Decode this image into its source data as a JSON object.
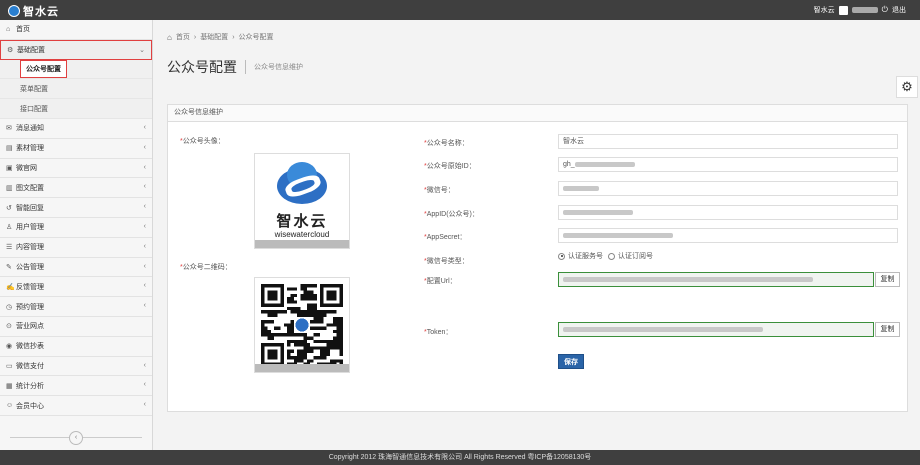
{
  "topbar": {
    "brand": "智水云",
    "user": "智水云",
    "logout": "退出"
  },
  "sidebar": {
    "items": [
      {
        "icon": "home-icon",
        "glyph": "⌂",
        "label": "首页"
      },
      {
        "icon": "gear-icon",
        "glyph": "⚙",
        "label": "基础配置",
        "expanded": true,
        "children": [
          {
            "label": "公众号配置",
            "current": true
          },
          {
            "label": "菜单配置"
          },
          {
            "label": "接口配置"
          }
        ]
      },
      {
        "icon": "message-icon",
        "glyph": "✉",
        "label": "消息通知"
      },
      {
        "icon": "material-icon",
        "glyph": "▤",
        "label": "素材管理"
      },
      {
        "icon": "site-icon",
        "glyph": "▣",
        "label": "微官网"
      },
      {
        "icon": "image-text-icon",
        "glyph": "▥",
        "label": "图文配置"
      },
      {
        "icon": "auto-reply-icon",
        "glyph": "↺",
        "label": "智能回复"
      },
      {
        "icon": "user-icon",
        "glyph": "♙",
        "label": "用户管理"
      },
      {
        "icon": "content-icon",
        "glyph": "☰",
        "label": "内容管理"
      },
      {
        "icon": "notice-icon",
        "glyph": "✎",
        "label": "公告管理"
      },
      {
        "icon": "feedback-icon",
        "glyph": "✍",
        "label": "反馈管理"
      },
      {
        "icon": "booking-icon",
        "glyph": "◷",
        "label": "预约管理"
      },
      {
        "icon": "location-icon",
        "glyph": "⊙",
        "label": "营业网点"
      },
      {
        "icon": "meter-icon",
        "glyph": "◉",
        "label": "微信抄表"
      },
      {
        "icon": "payment-icon",
        "glyph": "▭",
        "label": "微信支付"
      },
      {
        "icon": "stats-icon",
        "glyph": "▦",
        "label": "统计分析"
      },
      {
        "icon": "member-icon",
        "glyph": "☺",
        "label": "会员中心"
      }
    ]
  },
  "breadcrumb": [
    "首页",
    "基础配置",
    "公众号配置"
  ],
  "page": {
    "title": "公众号配置",
    "subtitle": "公众号信息维护"
  },
  "panel": {
    "title": "公众号信息维护",
    "avatar_label": "公众号头像：",
    "qr_label": "公众号二维码：",
    "logo_cn": "智水云",
    "logo_en": "wisewatercloud",
    "fields": {
      "name": {
        "label": "公众号名称：",
        "value": "智水云"
      },
      "original_id": {
        "label": "公众号原始ID：",
        "value": "gh_"
      },
      "wechat_id": {
        "label": "微信号：",
        "value": ""
      },
      "appid": {
        "label": "AppID(公众号)：",
        "value": ""
      },
      "appsecret": {
        "label": "AppSecret：",
        "value": ""
      },
      "type": {
        "label": "微信号类型：",
        "options": [
          "认证服务号",
          "认证订阅号"
        ],
        "selected": "认证服务号"
      },
      "url": {
        "label": "配置Url：",
        "value": ""
      },
      "token": {
        "label": "Token：",
        "value": ""
      }
    },
    "copy_label": "复制",
    "save_label": "保存"
  },
  "footer": "Copyright 2012 珠海智通信息技术有限公司 All Rights Reserved 粤ICP备12058130号"
}
